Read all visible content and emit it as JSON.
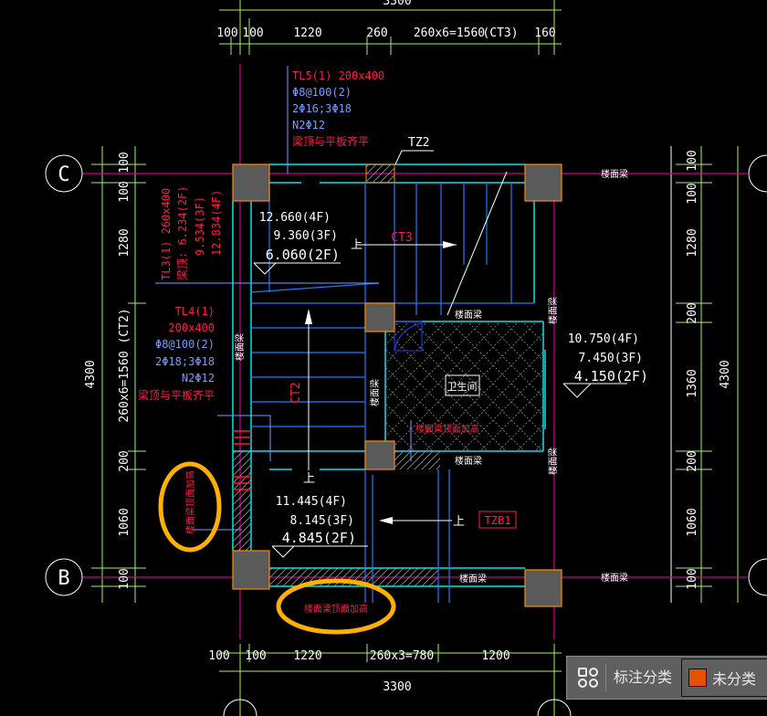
{
  "axes": {
    "c": "C",
    "b": "B"
  },
  "top_dims": {
    "total": "3300",
    "d1": "100",
    "d2": "100",
    "d3": "1220",
    "d4": "260",
    "d5": "260x6=1560",
    "d5_tag": "(CT3)",
    "d6": "160"
  },
  "bottom_dims": {
    "total": "3300",
    "d1": "100",
    "d2": "100",
    "d3": "1220",
    "d4": "260x3=780",
    "d5": "1200"
  },
  "left_dims": {
    "total": "4300",
    "d1": "100",
    "d2": "100",
    "d3": "1280",
    "d4": "260x6=1560 (CT2)",
    "d5": "200",
    "d6": "1060",
    "d7": "100"
  },
  "right_dims": {
    "total": "4300",
    "d1": "100",
    "d2": "100",
    "d3": "1280",
    "d4": "200",
    "d5": "1360",
    "d6": "200",
    "d7": "1060",
    "d8": "100"
  },
  "tl5": {
    "name": "TL5(1) 200x400",
    "stirrup": "Φ8@100(2)",
    "bars": "2Φ16;3Φ18",
    "side": "N2Φ12",
    "note": "梁顶与平板齐平"
  },
  "tl4": {
    "name": "TL4(1)",
    "size": "200x400",
    "stirrup": "Φ8@100(2)",
    "bars": "2Φ18;3Φ18",
    "side": "N2Φ12",
    "note": "梁顶与平板齐平"
  },
  "tl3": {
    "name": "TL3(1) 260x400",
    "top_2f": "梁顶: 6.234(2F)",
    "top_3f": "9.534(3F)",
    "top_4f": "12.834(4F)"
  },
  "tz2": "TZ2",
  "tzb1": "TZB1",
  "ct3": "CT3",
  "ct2": "CT2",
  "up": "上",
  "elev_top": {
    "f4": "12.660(4F)",
    "f3": "9.360(3F)",
    "f2": "6.060(2F)"
  },
  "elev_bottom": {
    "f4": "11.445(4F)",
    "f3": "8.145(3F)",
    "f2": "4.845(2F)"
  },
  "elev_right": {
    "f4": "10.750(4F)",
    "f3": "7.450(3F)",
    "f2": "4.150(2F)"
  },
  "room": "卫生间",
  "floor_beam": "楼面梁",
  "raise_note": "楼面梁顶面加高",
  "panel": {
    "label": "标注分类",
    "category": "未分类",
    "swatch_color": "#e65100"
  },
  "colors": {
    "dim": "#a6f06a",
    "axis": "#d0008f",
    "wall": "#00e5ee",
    "stair": "#1e7bff",
    "text_red": "#ff1a4a",
    "text_blue": "#7a9bff",
    "column": "#5a5a5a",
    "column_border": "#ff8a00",
    "highlight": "#ffb000"
  }
}
